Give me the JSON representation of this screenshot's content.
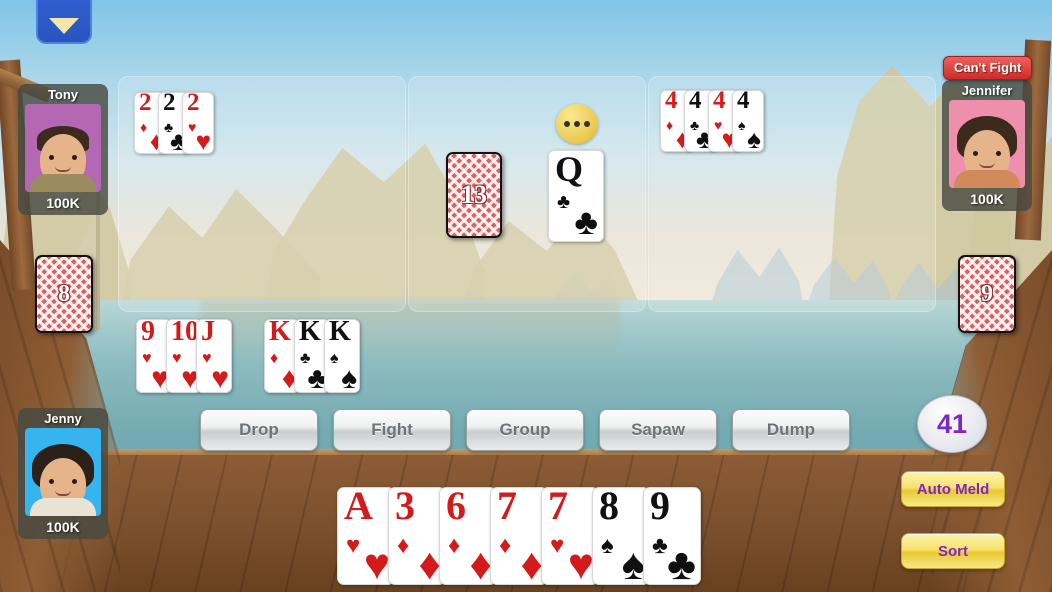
{
  "menu": {
    "icon": "chevron-down-icon"
  },
  "players": [
    {
      "id": "tony",
      "name": "Tony",
      "chips": "100K",
      "avatar_bg": "#b468b4"
    },
    {
      "id": "jennifer",
      "name": "Jennifer",
      "chips": "100K",
      "avatar_bg": "#ef8fae",
      "badge": "Can't Fight"
    },
    {
      "id": "jenny",
      "name": "Jenny",
      "chips": "100K",
      "avatar_bg": "#35b4ef"
    }
  ],
  "melds": [
    {
      "panel": 0,
      "cards": [
        {
          "rank": "2",
          "suit": "♦",
          "color": "red"
        },
        {
          "rank": "2",
          "suit": "♣",
          "color": "black"
        },
        {
          "rank": "2",
          "suit": "♥",
          "color": "red"
        }
      ]
    },
    {
      "panel": 2,
      "cards": [
        {
          "rank": "4",
          "suit": "♦",
          "color": "red"
        },
        {
          "rank": "4",
          "suit": "♣",
          "color": "black"
        },
        {
          "rank": "4",
          "suit": "♥",
          "color": "red"
        },
        {
          "rank": "4",
          "suit": "♠",
          "color": "black"
        }
      ]
    }
  ],
  "bottom_melds": [
    {
      "cards": [
        {
          "rank": "9",
          "suit": "♥",
          "color": "red"
        },
        {
          "rank": "10",
          "suit": "♥",
          "color": "red"
        },
        {
          "rank": "J",
          "suit": "♥",
          "color": "red"
        }
      ]
    },
    {
      "cards": [
        {
          "rank": "K",
          "suit": "♦",
          "color": "red"
        },
        {
          "rank": "K",
          "suit": "♣",
          "color": "black"
        },
        {
          "rank": "K",
          "suit": "♠",
          "color": "black"
        }
      ]
    }
  ],
  "center": {
    "stock_count": "13",
    "discard": {
      "rank": "Q",
      "suit": "♣",
      "color": "black"
    },
    "thinking_indicator": "thinking-dots-icon"
  },
  "side_piles": {
    "left_count": "8",
    "right_count": "9"
  },
  "hand": [
    {
      "rank": "A",
      "suit": "♥",
      "color": "red"
    },
    {
      "rank": "3",
      "suit": "♦",
      "color": "red"
    },
    {
      "rank": "6",
      "suit": "♦",
      "color": "red"
    },
    {
      "rank": "7",
      "suit": "♦",
      "color": "red"
    },
    {
      "rank": "7",
      "suit": "♥",
      "color": "red"
    },
    {
      "rank": "8",
      "suit": "♠",
      "color": "black"
    },
    {
      "rank": "9",
      "suit": "♣",
      "color": "black"
    }
  ],
  "actions": [
    {
      "label": "Drop"
    },
    {
      "label": "Fight"
    },
    {
      "label": "Group"
    },
    {
      "label": "Sapaw"
    },
    {
      "label": "Dump"
    }
  ],
  "side_panel": {
    "score": "41",
    "auto_meld_label": "Auto Meld",
    "sort_label": "Sort"
  },
  "colors": {
    "badge_red": "#cf2b28",
    "purple_text": "#7d27c9",
    "yellow_button": "#e9c92f",
    "menu_blue": "#2f62d6",
    "card_red": "#d41b1b"
  }
}
